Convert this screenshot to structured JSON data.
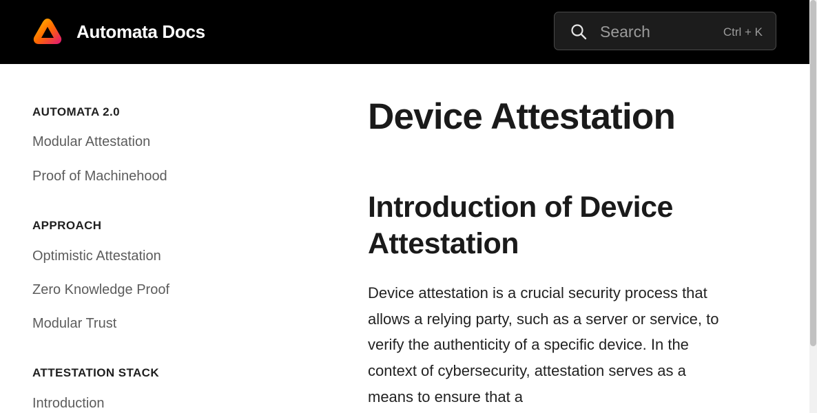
{
  "header": {
    "brand": "Automata Docs",
    "search": {
      "placeholder": "Search",
      "shortcut": "Ctrl + K"
    },
    "icons": {
      "logo": "automata-logo",
      "search": "search-icon"
    },
    "colors": {
      "background": "#000000",
      "logo_gradient": [
        "#ffb300",
        "#ff5a00",
        "#e0147a"
      ]
    }
  },
  "sidebar": {
    "sections": [
      {
        "heading": "AUTOMATA 2.0",
        "items": [
          "Modular Attestation",
          "Proof of Machinehood"
        ]
      },
      {
        "heading": "APPROACH",
        "items": [
          "Optimistic Attestation",
          "Zero Knowledge Proof",
          "Modular Trust"
        ]
      },
      {
        "heading": "ATTESTATION STACK",
        "items": [
          "Introduction"
        ]
      }
    ]
  },
  "main": {
    "title": "Device Attestation",
    "section_heading": "Introduction of Device Attestation",
    "paragraph": "Device attestation is a crucial security process that allows a relying party, such as a server or service, to verify the authenticity of a specific device. In the context of cybersecurity, attestation serves as a means to ensure that a"
  }
}
